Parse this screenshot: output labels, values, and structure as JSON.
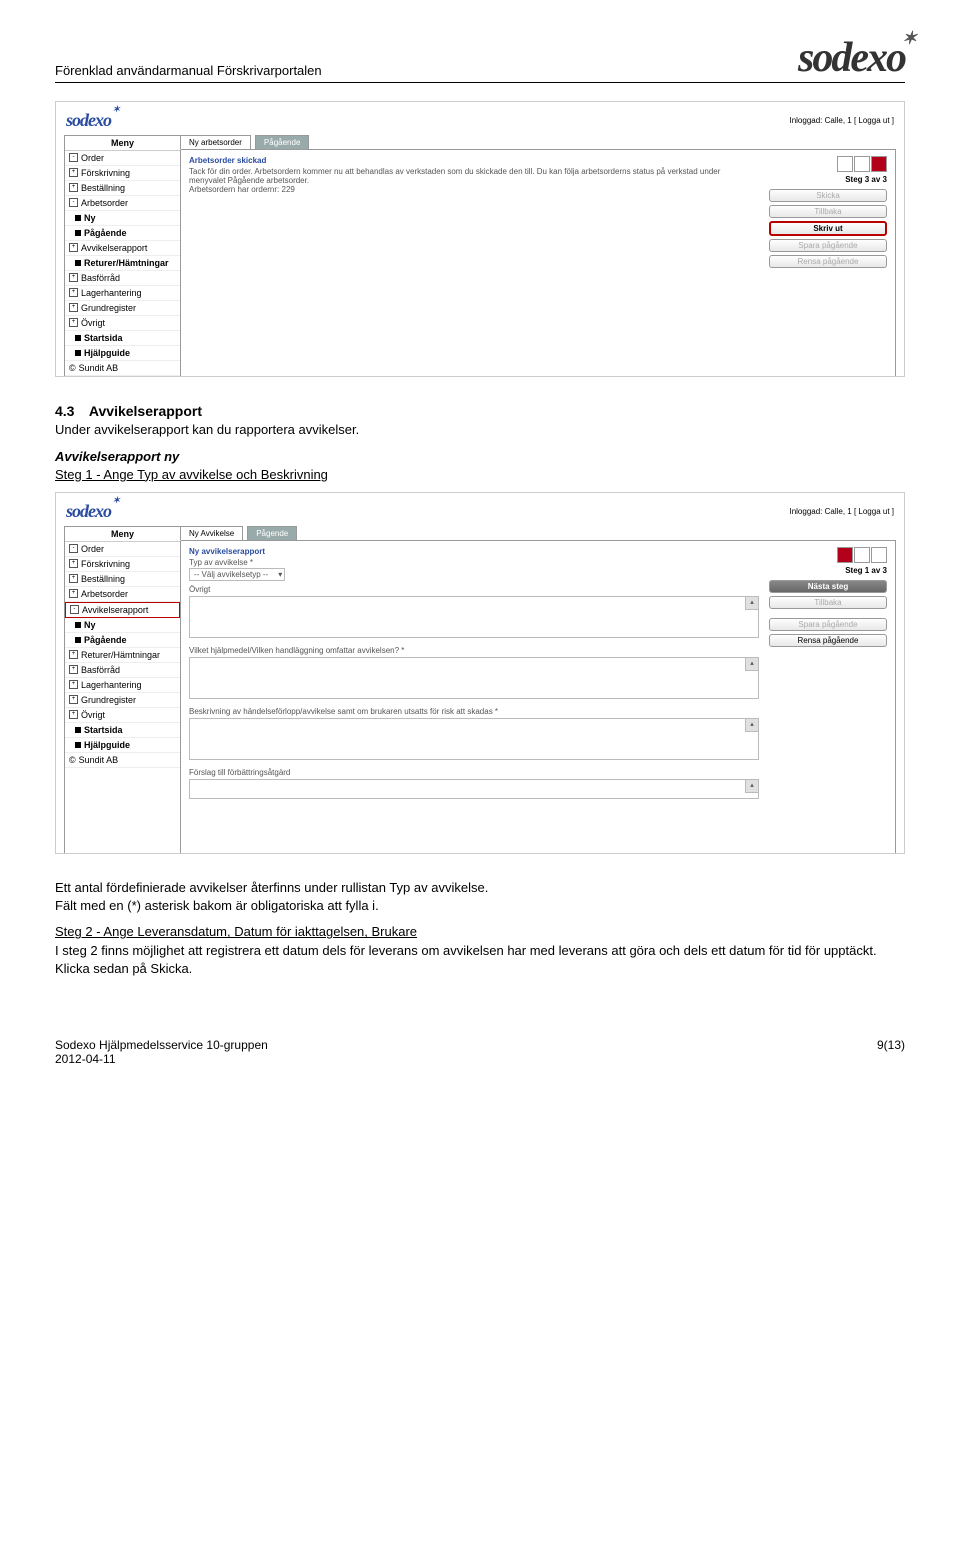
{
  "doc": {
    "header_title": "Förenklad användarmanual Förskrivarportalen",
    "logo": "sodexo"
  },
  "screenshot1": {
    "login_text": "Inloggad: Calle, 1 [ Logga ut ]",
    "logo": "sodexo",
    "menu_head": "Meny",
    "sidebar": [
      {
        "icon": "-",
        "label": "Order"
      },
      {
        "icon": "+",
        "label": "Förskrivning"
      },
      {
        "icon": "+",
        "label": "Beställning"
      },
      {
        "icon": "-",
        "label": "Arbetsorder"
      },
      {
        "icon": "b",
        "label": "Ny",
        "bold": true
      },
      {
        "icon": "b",
        "label": "Pågående",
        "bold": true
      },
      {
        "icon": "+",
        "label": "Avvikelserapport"
      },
      {
        "icon": "b",
        "label": "Returer/Hämtningar",
        "bold": true
      },
      {
        "icon": "+",
        "label": "Basförråd"
      },
      {
        "icon": "+",
        "label": "Lagerhantering"
      },
      {
        "icon": "+",
        "label": "Grundregister"
      },
      {
        "icon": "+",
        "label": "Övrigt"
      },
      {
        "icon": "b",
        "label": "Startsida",
        "bold": true
      },
      {
        "icon": "b",
        "label": "Hjälpguide",
        "bold": true
      },
      {
        "icon": "c",
        "label": "Sundit AB"
      }
    ],
    "tabs": [
      "Ny arbetsorder",
      "Pågående"
    ],
    "content": {
      "title": "Arbetsorder skickad",
      "line1": "Tack för din order. Arbetsordern kommer nu att behandlas av verkstaden som du skickade den till. Du kan följa arbetsorderns status på verkstad under menyvalet Pågående arbetsorder.",
      "line2": "Arbetsordern har ordernr: 229"
    },
    "right": {
      "step": "Steg 3 av 3",
      "buttons": [
        "Skicka",
        "Tillbaka",
        "Skriv ut",
        "Spara pågående",
        "Rensa pågående"
      ]
    }
  },
  "mid": {
    "heading_num": "4.3",
    "heading_text": "Avvikelserapport",
    "line": "Under avvikelserapport kan du rapportera avvikelser.",
    "sub_italic": "Avvikelserapport ny",
    "step1": "Steg 1 - Ange Typ av avvikelse och Beskrivning"
  },
  "screenshot2": {
    "login_text": "Inloggad: Calle, 1 [ Logga ut ]",
    "logo": "sodexo",
    "menu_head": "Meny",
    "sidebar": [
      {
        "icon": "-",
        "label": "Order"
      },
      {
        "icon": "+",
        "label": "Förskrivning"
      },
      {
        "icon": "+",
        "label": "Beställning"
      },
      {
        "icon": "+",
        "label": "Arbetsorder"
      },
      {
        "icon": "-",
        "label": "Avvikelserapport",
        "sel": true
      },
      {
        "icon": "b",
        "label": "Ny",
        "bold": true
      },
      {
        "icon": "b",
        "label": "Pågående",
        "bold": true
      },
      {
        "icon": "+",
        "label": "Returer/Hämtningar"
      },
      {
        "icon": "+",
        "label": "Basförråd"
      },
      {
        "icon": "+",
        "label": "Lagerhantering"
      },
      {
        "icon": "+",
        "label": "Grundregister"
      },
      {
        "icon": "+",
        "label": "Övrigt"
      },
      {
        "icon": "b",
        "label": "Startsida",
        "bold": true
      },
      {
        "icon": "b",
        "label": "Hjälpguide",
        "bold": true
      },
      {
        "icon": "c",
        "label": "Sundit AB"
      }
    ],
    "tabs": [
      "Ny Avvikelse",
      "Pågende"
    ],
    "content": {
      "title": "Ny avvikelserapport",
      "typ_label": "Typ av avvikelse *",
      "typ_value": "-- Välj avvikelsetyp --",
      "ovrigt": "Övrigt",
      "q1": "Vilket hjälpmedel/Vilken handläggning omfattar avvikelsen? *",
      "q2": "Beskrivning av händelseförlopp/avvikelse samt om brukaren utsatts för risk att skadas *",
      "q3": "Förslag till förbättringsåtgärd"
    },
    "right": {
      "step": "Steg 1 av 3",
      "buttons": [
        "Nästa steg",
        "Tillbaka",
        "Spara pågående",
        "Rensa pågående"
      ]
    }
  },
  "lower": {
    "p1": "Ett antal fördefinierade avvikelser återfinns under rullistan Typ av avvikelse.",
    "p2": "Fält med en (*) asterisk bakom är obligatoriska att fylla i.",
    "step2": "Steg 2 - Ange Leveransdatum, Datum för iakttagelsen, Brukare",
    "p3": "I steg 2 finns möjlighet att registrera ett datum dels för leverans om avvikelsen har med leverans att göra och dels ett datum för tid för upptäckt. Klicka sedan på Skicka."
  },
  "footer": {
    "left1": "Sodexo Hjälpmedelsservice 10-gruppen",
    "left2": "2012-04-11",
    "right": "9(13)"
  }
}
